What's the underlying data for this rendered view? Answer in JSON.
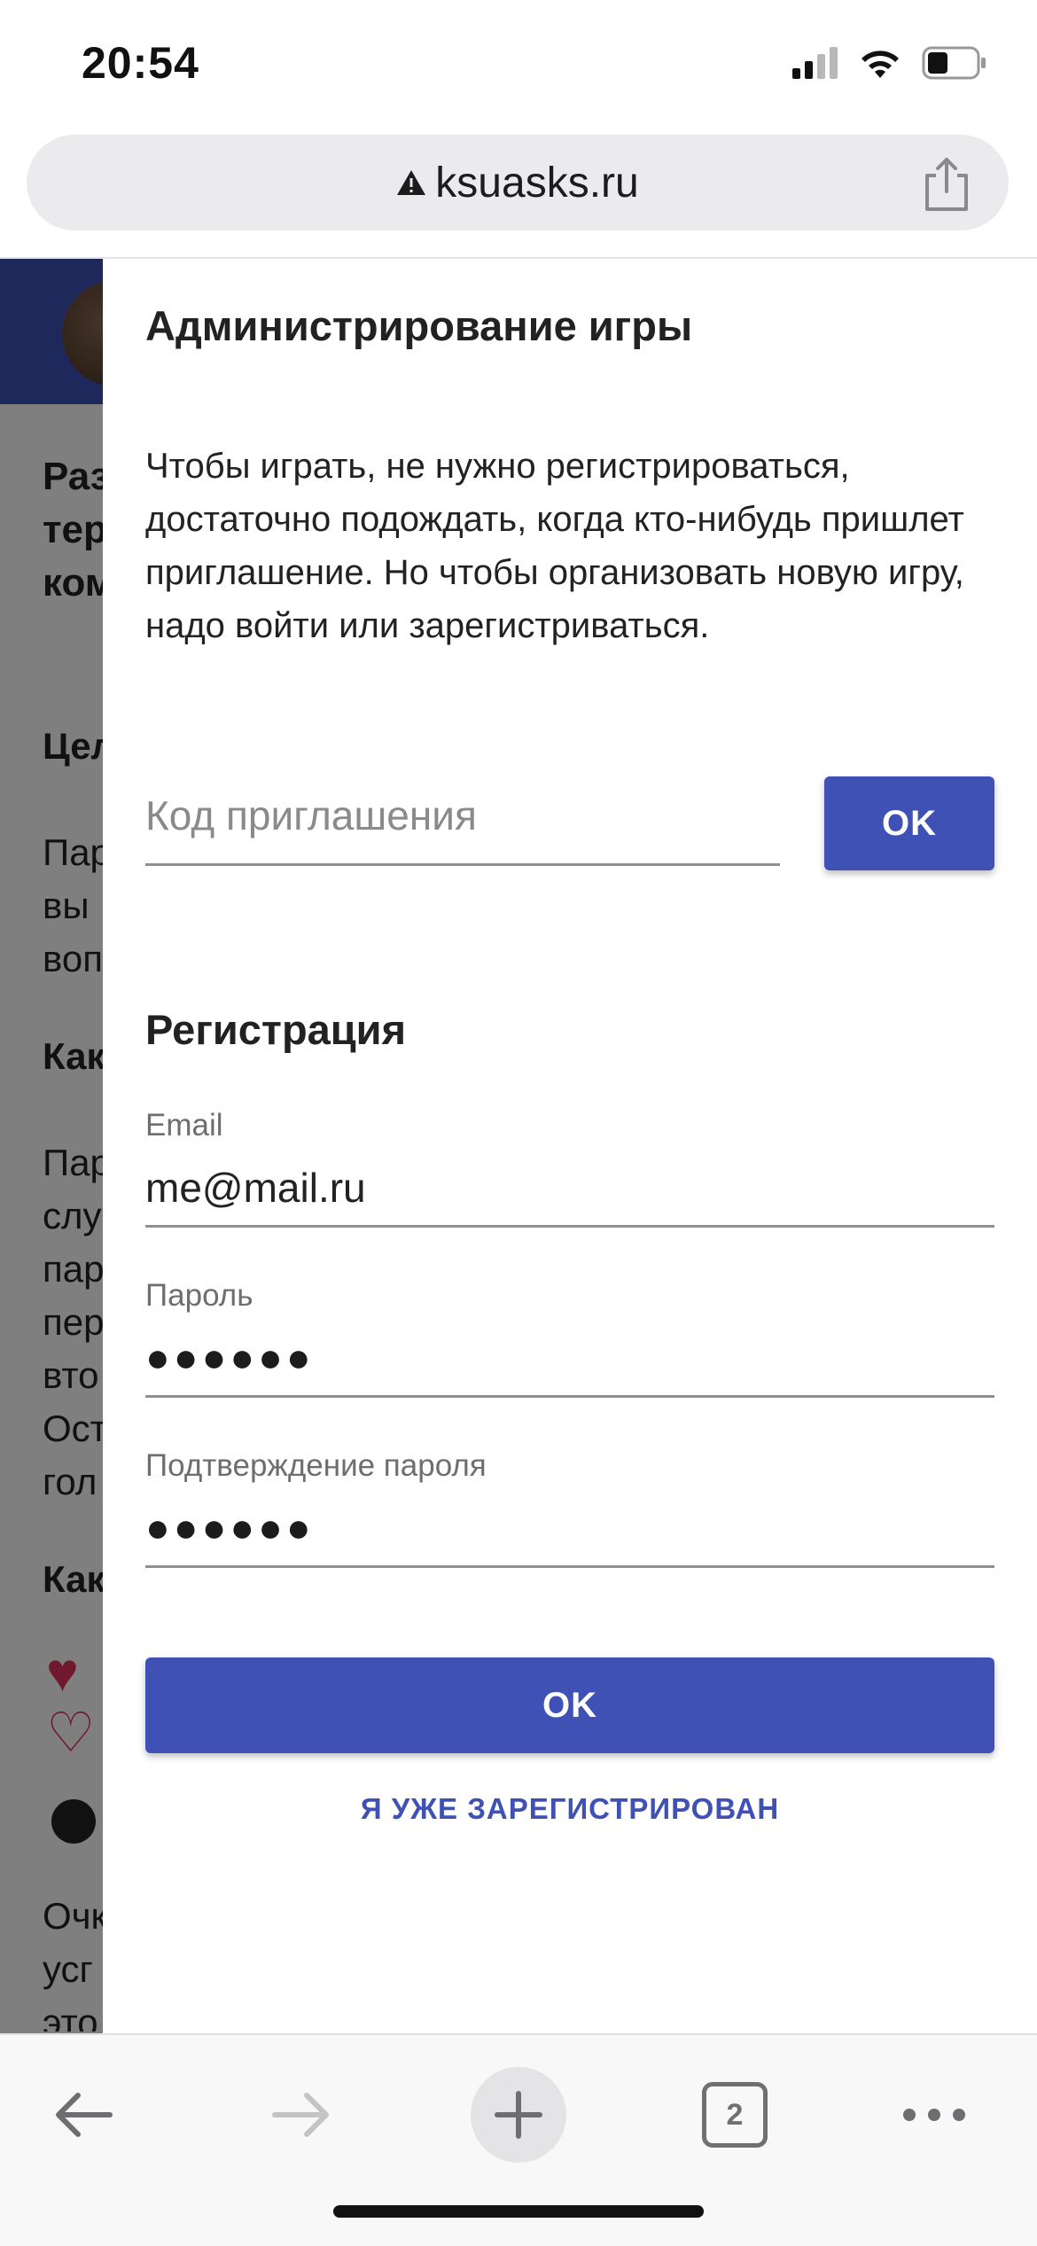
{
  "status_bar": {
    "time": "20:54",
    "icons": [
      "cellular-signal-icon",
      "wifi-icon",
      "battery-icon"
    ]
  },
  "browser": {
    "url": "ksuasks.ru",
    "security_icon": "warning-icon",
    "share_icon": "share-icon"
  },
  "background_page": {
    "title_fragment_lines": [
      "Раз",
      "тер",
      "ком"
    ],
    "section1_heading": "Цел",
    "section1_lines": [
      "Пар",
      "вы",
      "воп"
    ],
    "section2_heading": "Как",
    "section2_lines": [
      "Пар",
      "слу",
      "пар",
      "пер",
      "вто",
      "Ост",
      "гол"
    ],
    "section3_heading": "Как",
    "section4_lines": [
      "Очк",
      "усг",
      "это"
    ],
    "colors": {
      "header": "#3f51b5",
      "heart": "#e0325a"
    }
  },
  "dialog": {
    "title": "Администрирование игры",
    "description": "Чтобы играть, не нужно регистрироваться, достаточно подождать, когда кто-нибудь пришлет приглашение. Но чтобы организовать новую игру, надо войти или зарегистриваться.",
    "invite_placeholder": "Код приглашения",
    "invite_ok_label": "OK",
    "registration": {
      "title": "Регистрация",
      "email_label": "Email",
      "email_value": "me@mail.ru",
      "password_label": "Пароль",
      "password_mask": "●●●●●●",
      "confirm_label": "Подтверждение пароля",
      "confirm_mask": "●●●●●●",
      "submit_label": "OK",
      "already_registered_label": "Я УЖЕ ЗАРЕГИСТРИРОВАН"
    },
    "accent_color": "#3f51b5"
  },
  "toolbar": {
    "back_icon": "arrow-left-icon",
    "forward_icon": "arrow-right-icon",
    "new_tab_icon": "plus-icon",
    "tab_count": "2",
    "more_icon": "more-dots-icon"
  }
}
